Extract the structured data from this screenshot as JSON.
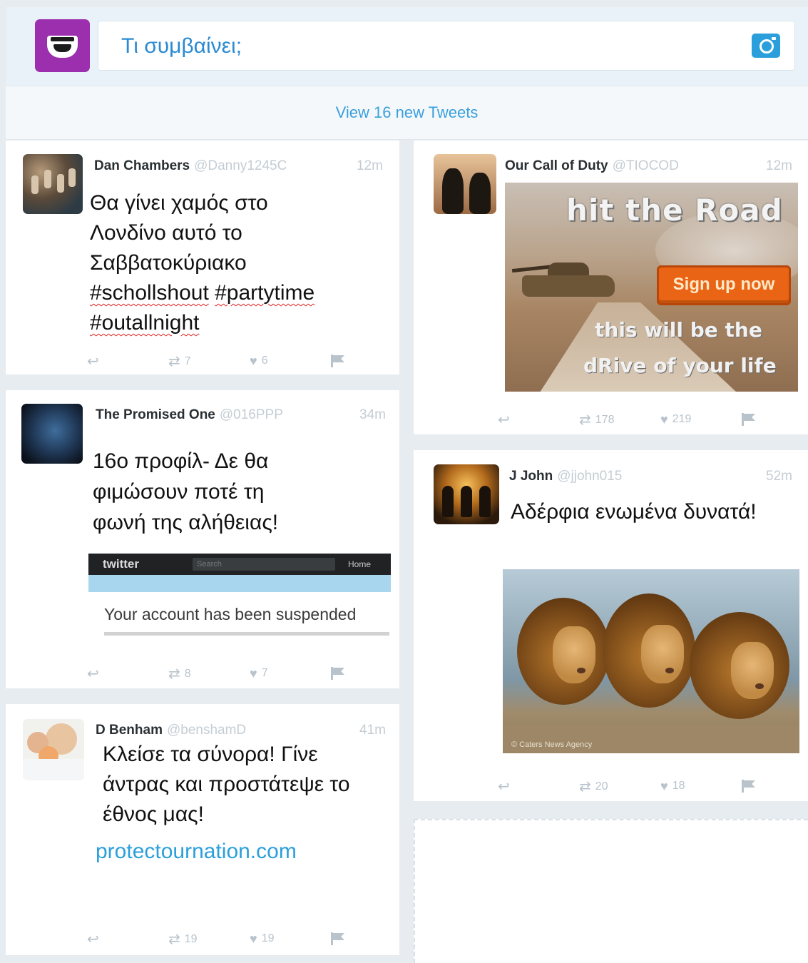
{
  "compose": {
    "placeholder": "Τι συμβαίνει;",
    "avatar_icon": "masked-face-icon",
    "camera_icon": "camera-icon",
    "accent_color": "#2b9fdb",
    "avatar_color": "#9b2fae"
  },
  "new_tweets": {
    "label": "View 16 new Tweets"
  },
  "tweets": [
    {
      "name": "Dan Chambers",
      "handle": "@Danny1245C",
      "time": "12m",
      "text_lines": [
        "Θα γίνει χαμός στο",
        "Λονδίνο αυτό το",
        "Σαββατοκύριακο"
      ],
      "hashtags": [
        "#schollshout",
        "#partytime",
        "#outallnight"
      ],
      "retweets": "7",
      "likes": "6"
    },
    {
      "name": "The Promised One",
      "handle": "@016PPP",
      "time": "34m",
      "text_lines": [
        "16ο προφίλ- Δε θα",
        "φιμώσουν ποτέ τη",
        "φωνή της αλήθειας!"
      ],
      "media": {
        "logo": "twitter",
        "search": "Search",
        "nav": "Home",
        "message": "Your account has been suspended"
      },
      "retweets": "8",
      "likes": "7"
    },
    {
      "name": "D Benham",
      "handle": "@benshamD",
      "time": "41m",
      "text_lines": [
        "Κλείσε τα σύνορα! Γίνε",
        "άντρας και προστάτεψε το",
        "έθνος μας!"
      ],
      "link": "protectournation.com",
      "retweets": "19",
      "likes": "19"
    },
    {
      "name": "Our Call of Duty",
      "handle": "@TIOCOD",
      "time": "12m",
      "ad": {
        "headline": "hit the Road",
        "button": "Sign up now",
        "tagline_1": "this will be the",
        "tagline_2": "dRive of your life"
      },
      "retweets": "178",
      "likes": "219"
    },
    {
      "name": "J John",
      "handle": "@jjohn015",
      "time": "52m",
      "text_lines": [
        "Αδέρφια ενωμένα δυνατά!"
      ],
      "media_credit": "© Caters News Agency",
      "retweets": "20",
      "likes": "18"
    }
  ]
}
